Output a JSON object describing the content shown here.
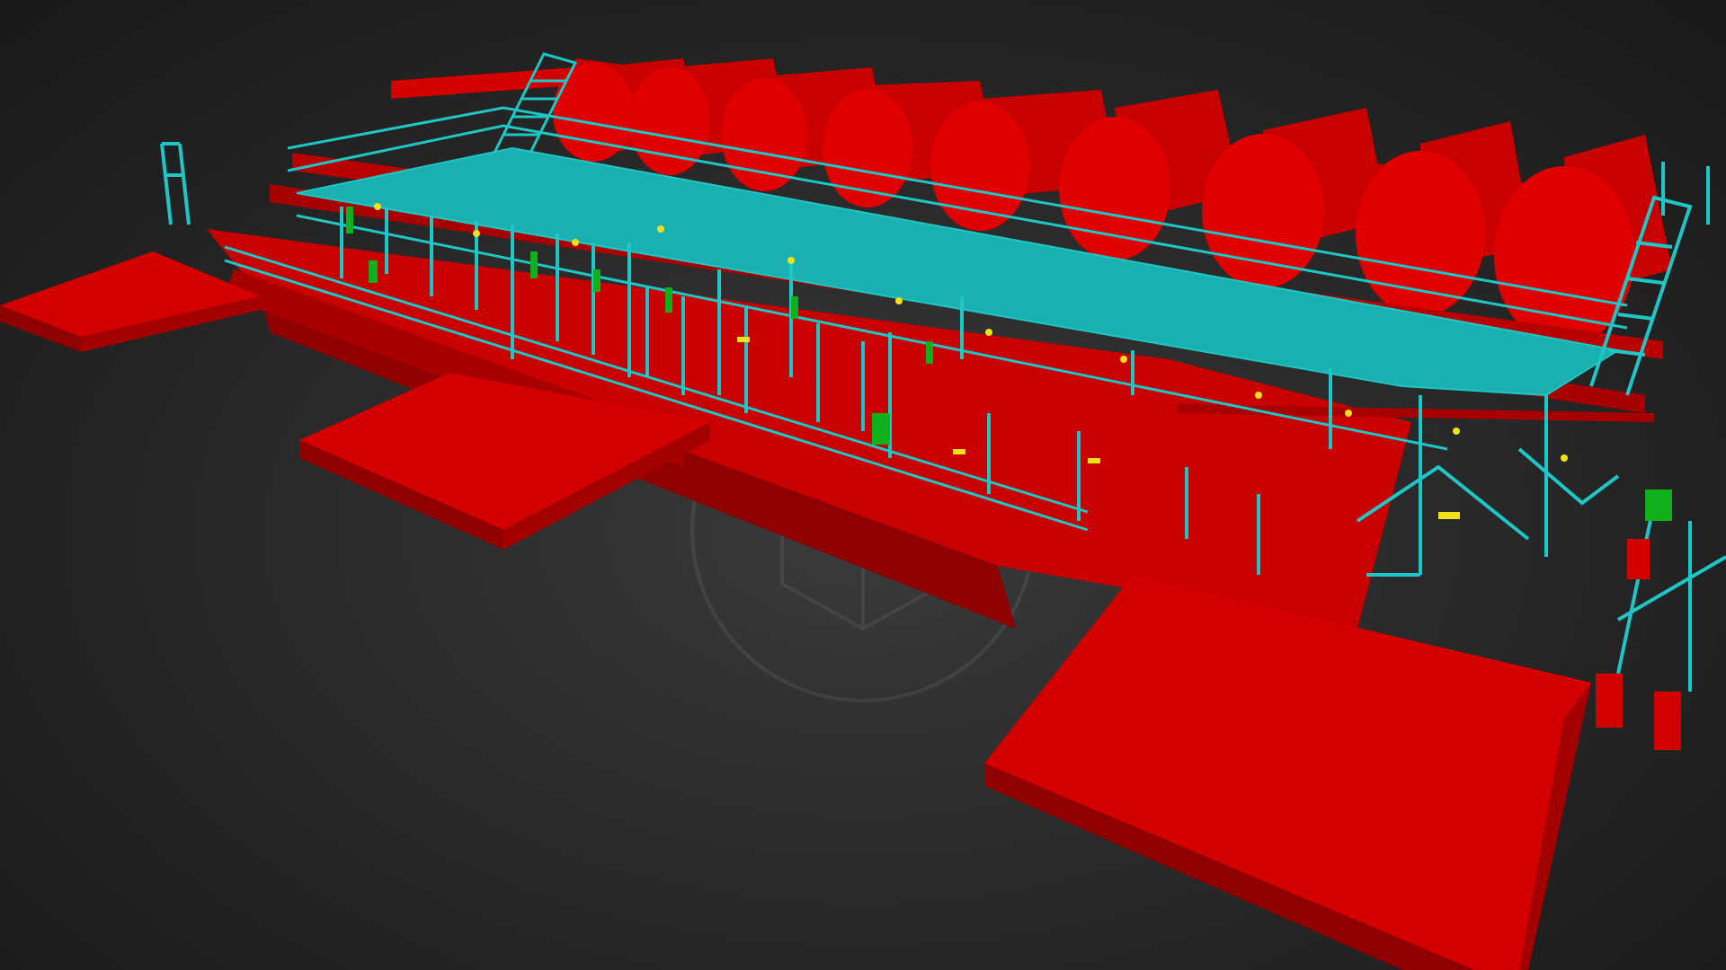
{
  "viewer": {
    "background_inner": "#3a3a3a",
    "background_outer": "#181818"
  },
  "colors": {
    "structure_red": "#d40000",
    "structure_red_dark": "#9a0000",
    "structure_red_side": "#b30000",
    "steel_cyan": "#1fc6c6",
    "steel_cyan_dark": "#159a9a",
    "valve_green": "#10b01c",
    "bolt_yellow": "#f2e11a"
  },
  "icons": {
    "watermark": "sketchfab-logo-watermark-icon"
  },
  "tanks": {
    "count": 9,
    "color_name": "red"
  },
  "platforms": {
    "count": 4
  }
}
